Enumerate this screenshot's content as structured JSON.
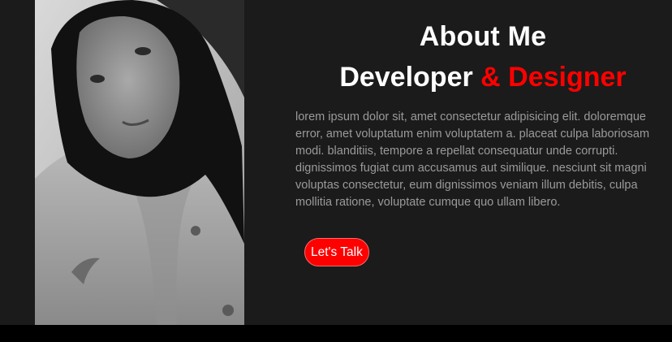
{
  "about": {
    "title": "About Me",
    "subtitle_main": "Developer",
    "subtitle_accent": "& Designer",
    "description": "lorem ipsum dolor sit, amet consectetur adipisicing elit. doloremque error, amet voluptatum enim voluptatem a. placeat culpa laboriosam modi. blanditiis, tempore a repellat consequatur unde corrupti. dignissimos fugiat cum accusamus aut similique. nesciunt sit magni voluptas consectetur, eum dignissimos veniam illum debitis, culpa mollitia ratione, voluptate cumque quo ullam libero.",
    "cta_label": "Let's Talk"
  },
  "colors": {
    "background": "#1b1b1b",
    "accent": "#ff0000",
    "text_muted": "#9a9a9a"
  }
}
